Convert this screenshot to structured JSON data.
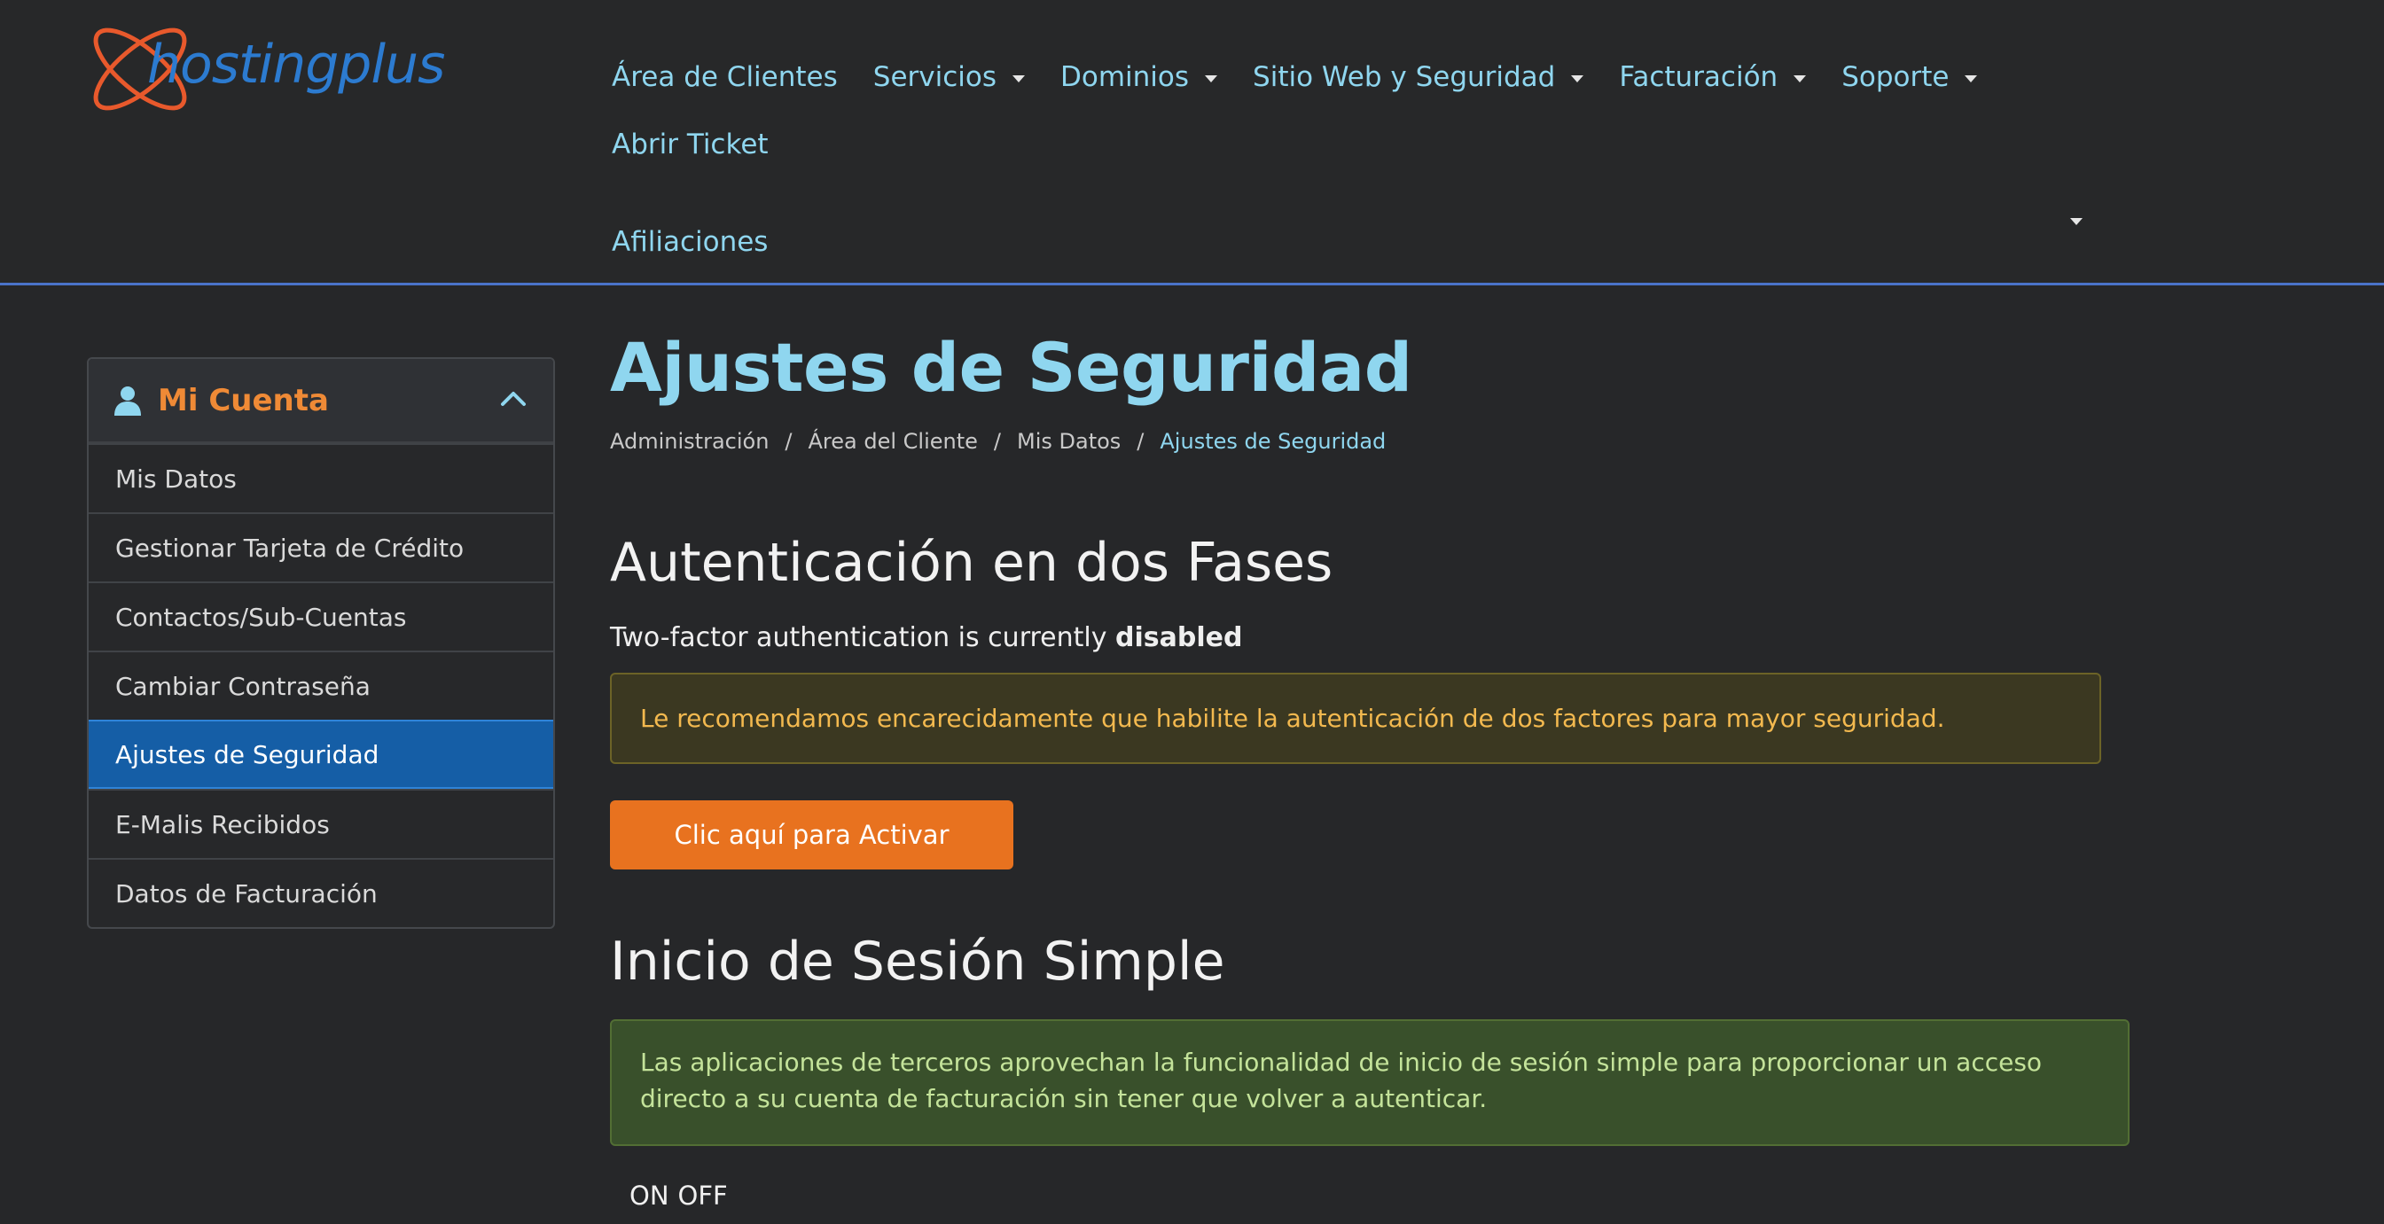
{
  "header": {
    "logo_text": "hostingplus",
    "nav": [
      {
        "label": "Área de Clientes",
        "dropdown": false
      },
      {
        "label": "Servicios",
        "dropdown": true
      },
      {
        "label": "Dominios",
        "dropdown": true
      },
      {
        "label": "Sitio Web y Seguridad",
        "dropdown": true
      },
      {
        "label": "Facturación",
        "dropdown": true
      },
      {
        "label": "Soporte",
        "dropdown": true
      },
      {
        "label": "Abrir Ticket",
        "dropdown": false
      },
      {
        "label": "Afiliaciones",
        "dropdown": false
      }
    ]
  },
  "sidebar": {
    "title": "Mi Cuenta",
    "items": [
      {
        "label": "Mis Datos"
      },
      {
        "label": "Gestionar Tarjeta de Crédito"
      },
      {
        "label": "Contactos/Sub-Cuentas"
      },
      {
        "label": "Cambiar Contraseña"
      },
      {
        "label": "Ajustes de Seguridad",
        "active": true
      },
      {
        "label": "E-Malis Recibidos"
      },
      {
        "label": "Datos de Facturación"
      }
    ]
  },
  "main": {
    "title": "Ajustes de Seguridad",
    "breadcrumb": [
      "Administración",
      "Área del Cliente",
      "Mis Datos",
      "Ajustes de Seguridad"
    ],
    "two_factor": {
      "title": "Autenticación en dos Fases",
      "status_prefix": "Two-factor authentication is currently",
      "status_value": "disabled",
      "warning": "Le recomendamos encarecidamente que habilite la autenticación de dos factores para mayor seguridad.",
      "activate_button": "Clic aquí para Activar"
    },
    "sso": {
      "title": "Inicio de Sesión Simple",
      "info": "Las aplicaciones de terceros aprovechan la funcionalidad de inicio de sesión simple para proporcionar un acceso directo a su cuenta de facturación sin tener que volver a autenticar.",
      "toggle_on": "ON",
      "toggle_off": "OFF"
    }
  },
  "colors": {
    "background": "#262729",
    "accent_cyan": "#8fd6ef",
    "accent_orange": "#e8721f",
    "active_blue": "#155ea6",
    "header_border": "#4a73c9"
  }
}
